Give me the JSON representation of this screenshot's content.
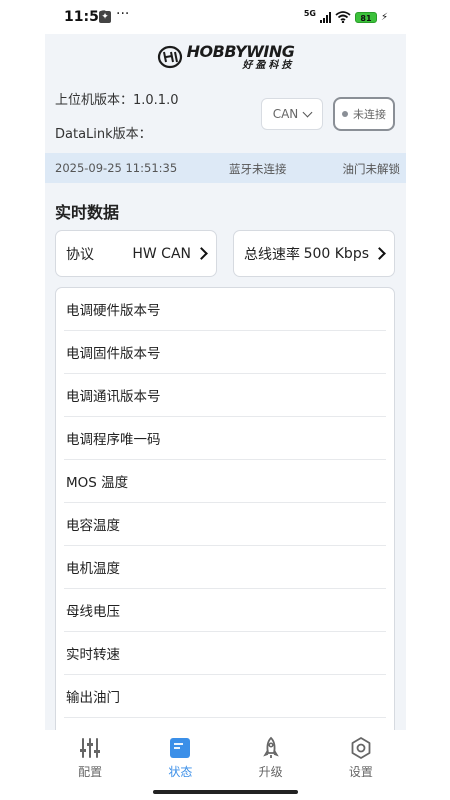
{
  "status_bar": {
    "time": "11:51",
    "dots": "···",
    "network": "5G",
    "battery": "81"
  },
  "brand": {
    "name_en": "HOBBYWING",
    "name_cn": "好盈科技"
  },
  "header": {
    "host_version_label": "上位机版本：1.0.1.0",
    "datalink_version_label": "DataLink版本：",
    "protocol_select": "CAN",
    "connect_button": "未连接"
  },
  "info_strip": {
    "datetime": "2025-09-25 11:51:35",
    "bluetooth_status": "蓝牙未连接",
    "throttle_status": "油门未解锁"
  },
  "realtime": {
    "title": "实时数据",
    "protocol": {
      "label": "协议",
      "value": "HW CAN"
    },
    "bus_rate": {
      "label": "总线速率",
      "value": "500 Kbps"
    },
    "items": [
      {
        "label": "电调硬件版本号"
      },
      {
        "label": "电调固件版本号"
      },
      {
        "label": "电调通讯版本号"
      },
      {
        "label": "电调程序唯一码"
      },
      {
        "label": "MOS 温度"
      },
      {
        "label": "电容温度"
      },
      {
        "label": "电机温度"
      },
      {
        "label": "母线电压"
      },
      {
        "label": "实时转速"
      },
      {
        "label": "输出油门"
      },
      {
        "label": ""
      }
    ]
  },
  "tabbar": {
    "tabs": [
      {
        "label": "配置",
        "icon": "sliders-icon",
        "active": false
      },
      {
        "label": "状态",
        "icon": "document-icon",
        "active": true
      },
      {
        "label": "升级",
        "icon": "rocket-icon",
        "active": false
      },
      {
        "label": "设置",
        "icon": "gear-icon",
        "active": false
      }
    ],
    "active_color": "#3b8fe8"
  }
}
